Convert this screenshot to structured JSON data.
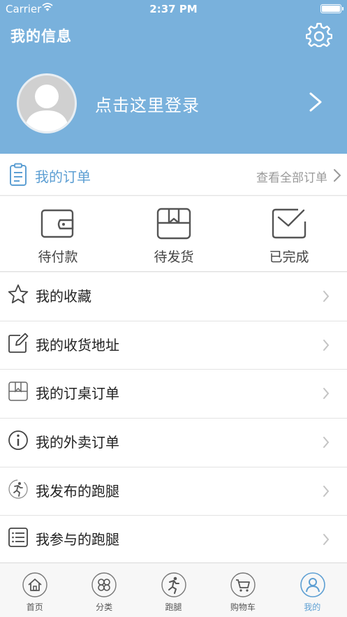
{
  "status_bar": {
    "carrier": "Carrier",
    "time": "2:37 PM"
  },
  "header": {
    "title": "我的信息",
    "login_text": "点击这里登录"
  },
  "orders": {
    "title": "我的订单",
    "view_all": "查看全部订单"
  },
  "order_status": [
    {
      "label": "待付款",
      "icon": "wallet-icon"
    },
    {
      "label": "待发货",
      "icon": "package-icon"
    },
    {
      "label": "已完成",
      "icon": "mail-check-icon"
    }
  ],
  "menu": [
    {
      "label": "我的收藏",
      "icon": "star-icon"
    },
    {
      "label": "我的收货地址",
      "icon": "edit-icon"
    },
    {
      "label": "我的订桌订单",
      "icon": "bookmark-box-icon"
    },
    {
      "label": "我的外卖订单",
      "icon": "info-icon"
    },
    {
      "label": "我发布的跑腿",
      "icon": "runner-icon"
    },
    {
      "label": "我参与的跑腿",
      "icon": "list-icon"
    }
  ],
  "tabs": [
    {
      "label": "首页",
      "icon": "home-icon"
    },
    {
      "label": "分类",
      "icon": "category-icon"
    },
    {
      "label": "跑腿",
      "icon": "runner-icon"
    },
    {
      "label": "购物车",
      "icon": "cart-icon"
    },
    {
      "label": "我的",
      "icon": "user-icon",
      "active": true
    }
  ],
  "colors": {
    "header": "#79b1dc",
    "accent": "#5d9fd3"
  }
}
